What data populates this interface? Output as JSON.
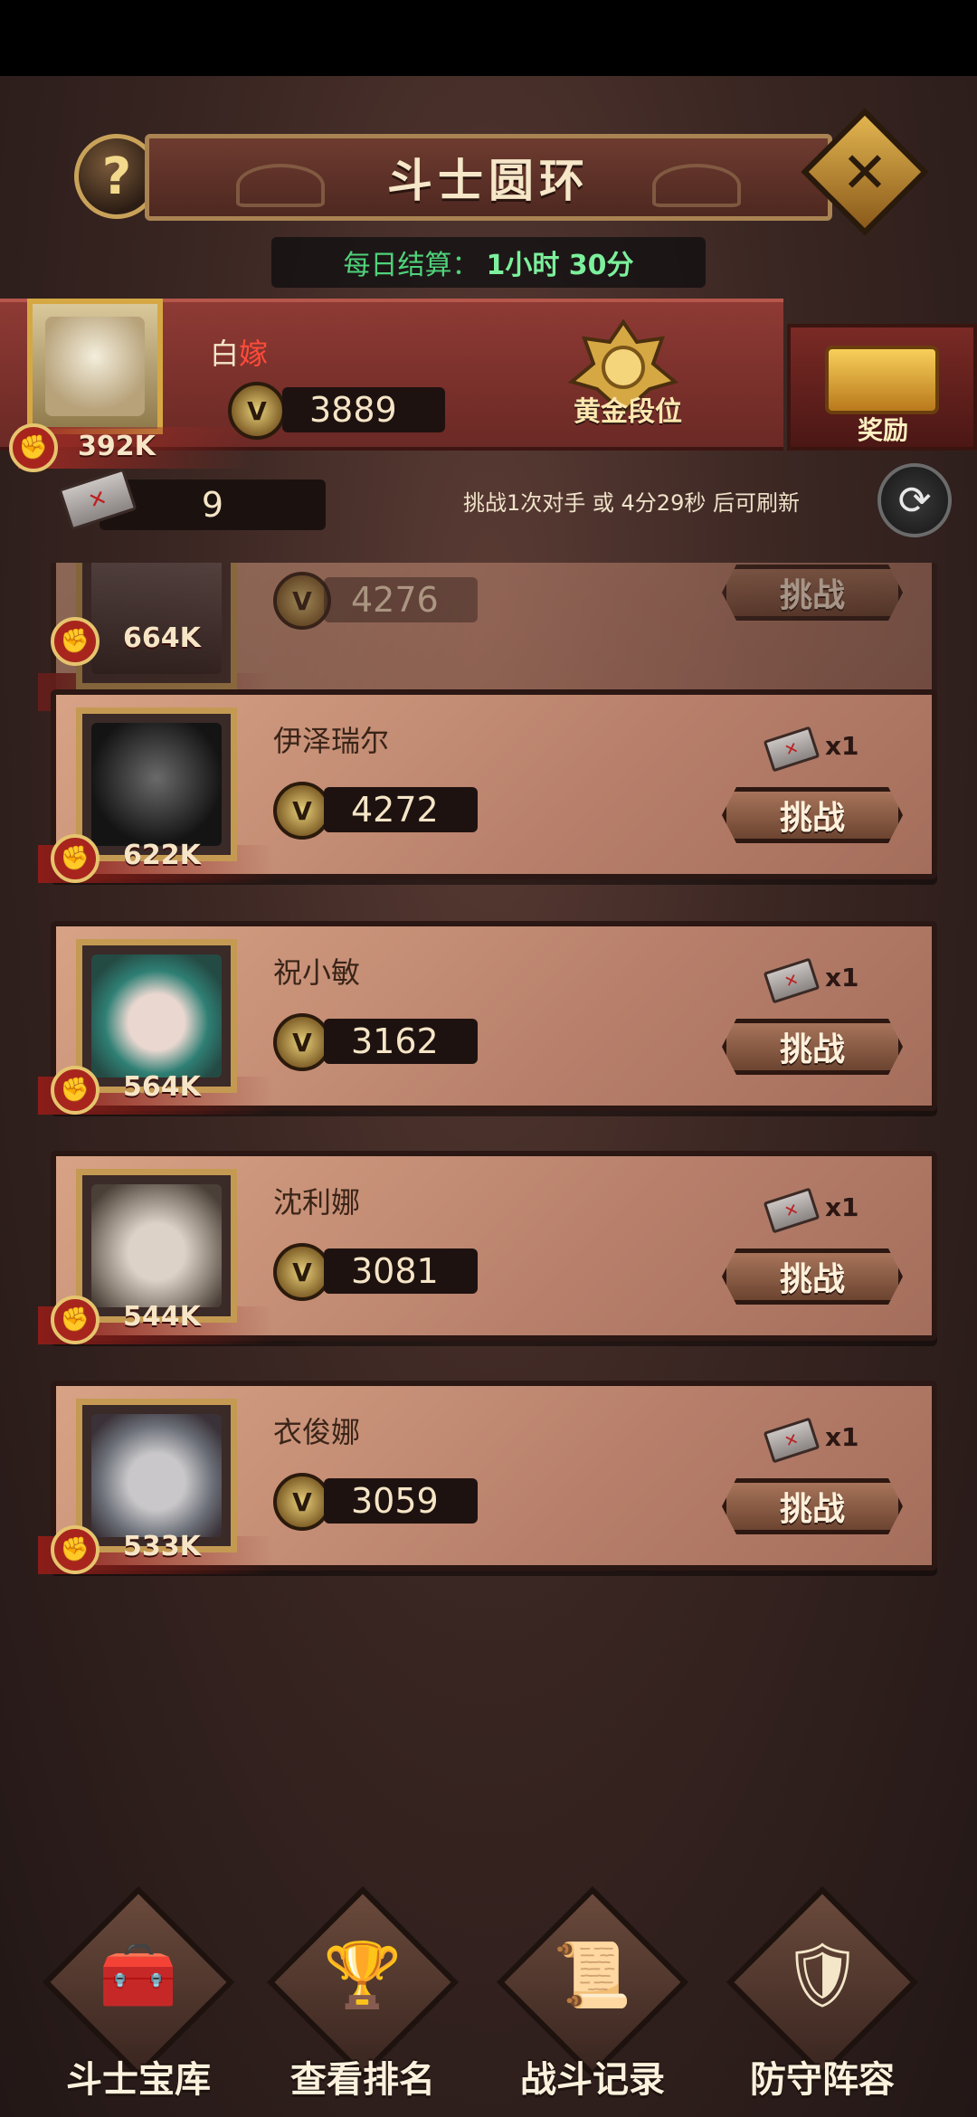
{
  "header": {
    "help_glyph": "?",
    "title": "斗士圆环",
    "close_glyph": "✕"
  },
  "settlement": {
    "label": "每日结算：",
    "value": "1小时 30分"
  },
  "player": {
    "name_prefix": "白",
    "name_highlight": "嫁",
    "score": "3889",
    "power": "392K",
    "rank_label": "黄金段位",
    "reward_label": "奖励"
  },
  "tickets": {
    "count": "9",
    "refresh_text": "挑战1次对手 或 4分29秒 后可刷新"
  },
  "opponents": [
    {
      "name": "",
      "score": "4276",
      "power": "664K",
      "cost": "",
      "button": "挑战",
      "faded": true
    },
    {
      "name": "伊泽瑞尔",
      "score": "4272",
      "power": "622K",
      "cost": "x1",
      "button": "挑战"
    },
    {
      "name": "祝小敏",
      "score": "3162",
      "power": "564K",
      "cost": "x1",
      "button": "挑战"
    },
    {
      "name": "沈利娜",
      "score": "3081",
      "power": "544K",
      "cost": "x1",
      "button": "挑战"
    },
    {
      "name": "衣俊娜",
      "score": "3059",
      "power": "533K",
      "cost": "x1",
      "button": "挑战"
    }
  ],
  "bottom_nav": [
    {
      "label": "斗士宝库",
      "icon": "treasure-chest-icon"
    },
    {
      "label": "查看排名",
      "icon": "trophy-icon"
    },
    {
      "label": "战斗记录",
      "icon": "scroll-icon"
    },
    {
      "label": "防守阵容",
      "icon": "shield-icon"
    }
  ],
  "colors": {
    "player_bar": "#8e3a34",
    "card": "#c8927a",
    "gold": "#d6a844",
    "timer_green": "#4fd27a",
    "name_highlight": "#ff4b3a"
  }
}
